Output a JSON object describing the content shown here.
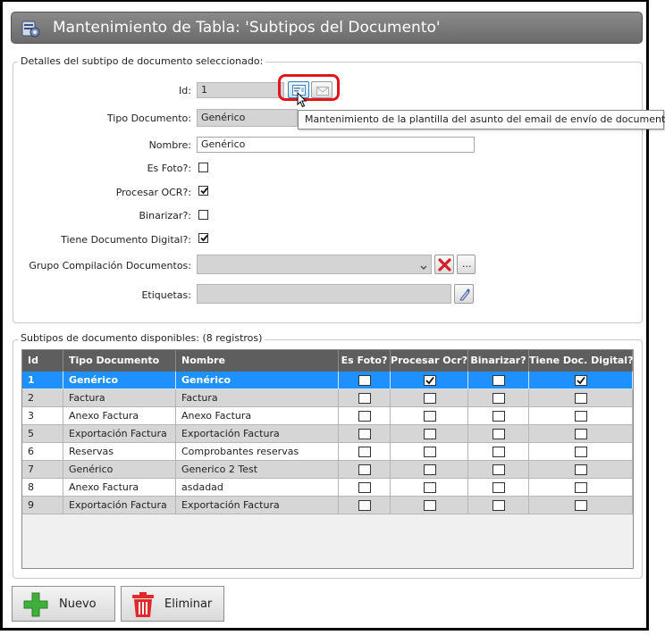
{
  "window": {
    "title": "Mantenimiento de Tabla: 'Subtipos del Documento'"
  },
  "details": {
    "legend": "Detalles del subtipo de documento seleccionado:",
    "fields": {
      "id_label": "Id:",
      "id_value": "1",
      "tipo_label": "Tipo Documento:",
      "tipo_value": "Genérico",
      "nombre_label": "Nombre:",
      "nombre_value": "Genérico",
      "es_foto_label": "Es Foto?:",
      "es_foto": false,
      "procesar_ocr_label": "Procesar OCR?:",
      "procesar_ocr": true,
      "binarizar_label": "Binarizar?:",
      "binarizar": false,
      "tiene_doc_label": "Tiene Documento Digital?:",
      "tiene_doc": true,
      "grupo_label": "Grupo Compilación Documentos:",
      "grupo_value": "",
      "grupo_browse_label": "...",
      "etiquetas_label": "Etiquetas:",
      "etiquetas_value": ""
    },
    "tooltip": "Mantenimiento de la plantilla del asunto del email de envío de documento"
  },
  "list": {
    "legend": "Subtipos de documento disponibles:  (8 registros)",
    "columns": [
      "Id",
      "Tipo Documento",
      "Nombre",
      "Es Foto?",
      "Procesar Ocr?",
      "Binarizar?",
      "Tiene Doc. Digital?"
    ],
    "rows": [
      {
        "id": "1",
        "tipo": "Genérico",
        "nombre": "Genérico",
        "es_foto": false,
        "ocr": true,
        "binarizar": false,
        "digital": true,
        "selected": true
      },
      {
        "id": "2",
        "tipo": "Factura",
        "nombre": "Factura",
        "es_foto": false,
        "ocr": false,
        "binarizar": false,
        "digital": false
      },
      {
        "id": "3",
        "tipo": "Anexo Factura",
        "nombre": "Anexo Factura",
        "es_foto": false,
        "ocr": false,
        "binarizar": false,
        "digital": false
      },
      {
        "id": "5",
        "tipo": "Exportación Factura",
        "nombre": "Exportación Factura",
        "es_foto": false,
        "ocr": false,
        "binarizar": false,
        "digital": false
      },
      {
        "id": "6",
        "tipo": "Reservas",
        "nombre": "Comprobantes reservas",
        "es_foto": false,
        "ocr": false,
        "binarizar": false,
        "digital": false
      },
      {
        "id": "7",
        "tipo": "Genérico",
        "nombre": "Generico 2 Test",
        "es_foto": false,
        "ocr": false,
        "binarizar": false,
        "digital": false
      },
      {
        "id": "8",
        "tipo": "Anexo Factura",
        "nombre": "asdadad",
        "es_foto": false,
        "ocr": false,
        "binarizar": false,
        "digital": false
      },
      {
        "id": "9",
        "tipo": "Exportación Factura",
        "nombre": "Exportación Factura",
        "es_foto": false,
        "ocr": false,
        "binarizar": false,
        "digital": false
      }
    ]
  },
  "actions": {
    "new_label": "Nuevo",
    "delete_label": "Eliminar"
  },
  "colors": {
    "selected_row": "#1e90ff",
    "odd_row": "#ffffff",
    "even_row": "#d6d6d6",
    "header": "#5e5e5e",
    "highlight_ring": "#e3161d"
  },
  "icons": [
    "settings-app-icon",
    "template-edit-icon",
    "email-icon",
    "clear-x-icon",
    "tag-edit-icon",
    "plus-icon",
    "trash-icon",
    "mouse-cursor-icon"
  ]
}
